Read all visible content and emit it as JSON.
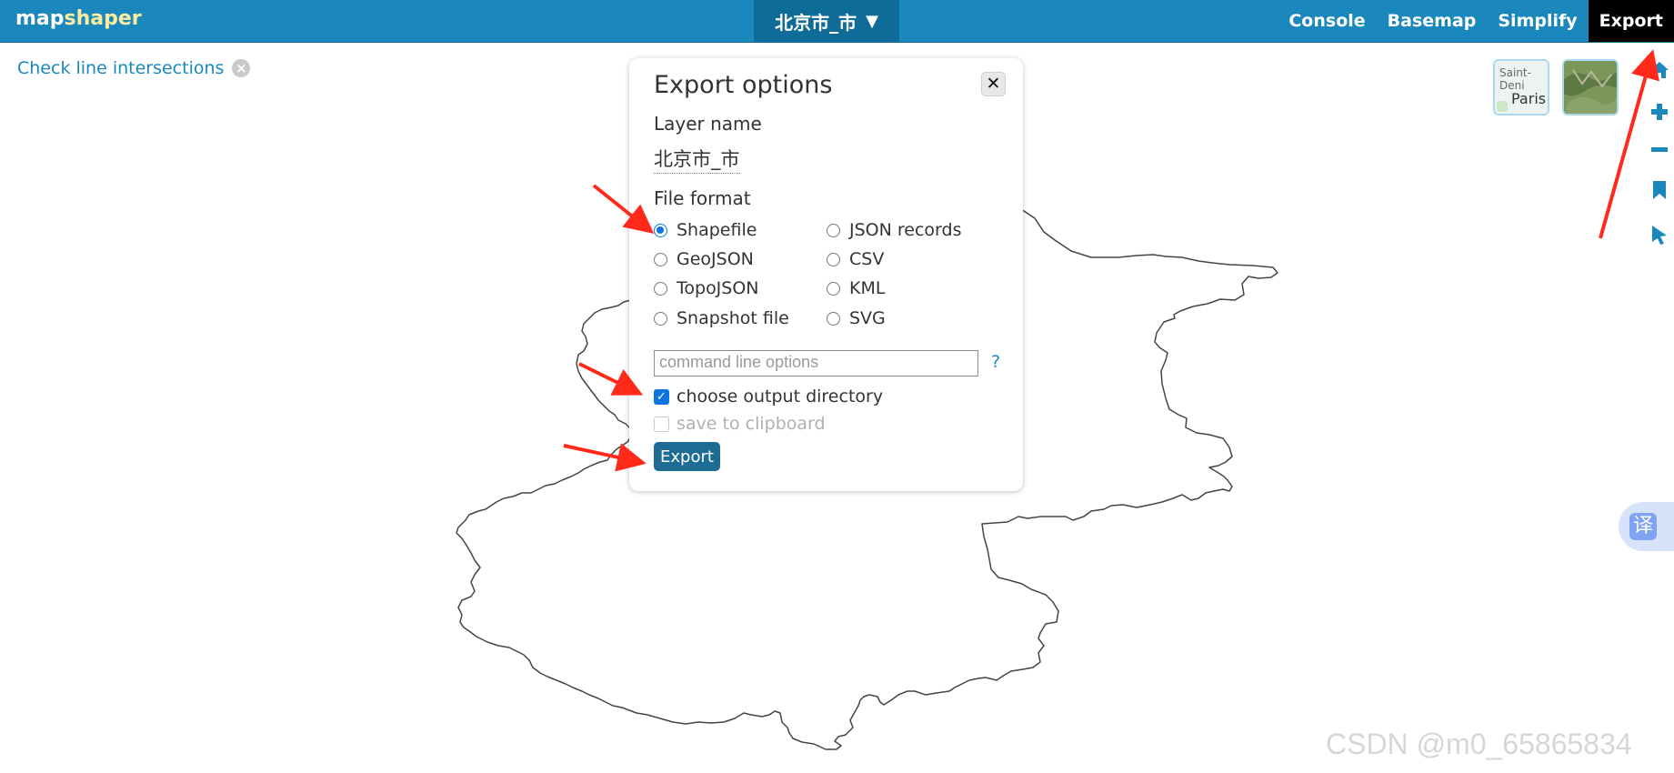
{
  "app": {
    "logo_part1": "map",
    "logo_part2": "shaper",
    "layer_selector": "北京市_市",
    "layer_caret": "▼",
    "nav": {
      "console": "Console",
      "basemap": "Basemap",
      "simplify": "Simplify",
      "export": "Export"
    }
  },
  "tools": {
    "check_intersections": "Check line intersections",
    "clear": "×"
  },
  "basemaps": {
    "streets_label_top": "Saint-Deni",
    "streets_label_city": "Paris"
  },
  "dialog": {
    "title": "Export options",
    "close": "✕",
    "layer_name_label": "Layer name",
    "layer_name_value": "北京市_市",
    "file_format_label": "File format",
    "formats": [
      {
        "label": "Shapefile",
        "selected": true
      },
      {
        "label": "GeoJSON",
        "selected": false
      },
      {
        "label": "TopoJSON",
        "selected": false
      },
      {
        "label": "Snapshot file",
        "selected": false
      },
      {
        "label": "JSON records",
        "selected": false
      },
      {
        "label": "CSV",
        "selected": false
      },
      {
        "label": "KML",
        "selected": false
      },
      {
        "label": "SVG",
        "selected": false
      }
    ],
    "command_placeholder": "command line options",
    "help": "?",
    "choose_output_directory": "choose output directory",
    "choose_output_directory_checked": true,
    "save_to_clipboard": "save to clipboard",
    "save_to_clipboard_checked": false,
    "export_button": "Export"
  },
  "translate_widget": "译",
  "watermark": "CSDN @m0_65865834",
  "colors": {
    "topbar": "#1a87bd",
    "layer_button": "#0f6b98",
    "export_active": "#000000",
    "radio_selected": "#0b75e0",
    "export_button": "#1e6b93",
    "annotation_arrow": "#ff2a1a"
  }
}
